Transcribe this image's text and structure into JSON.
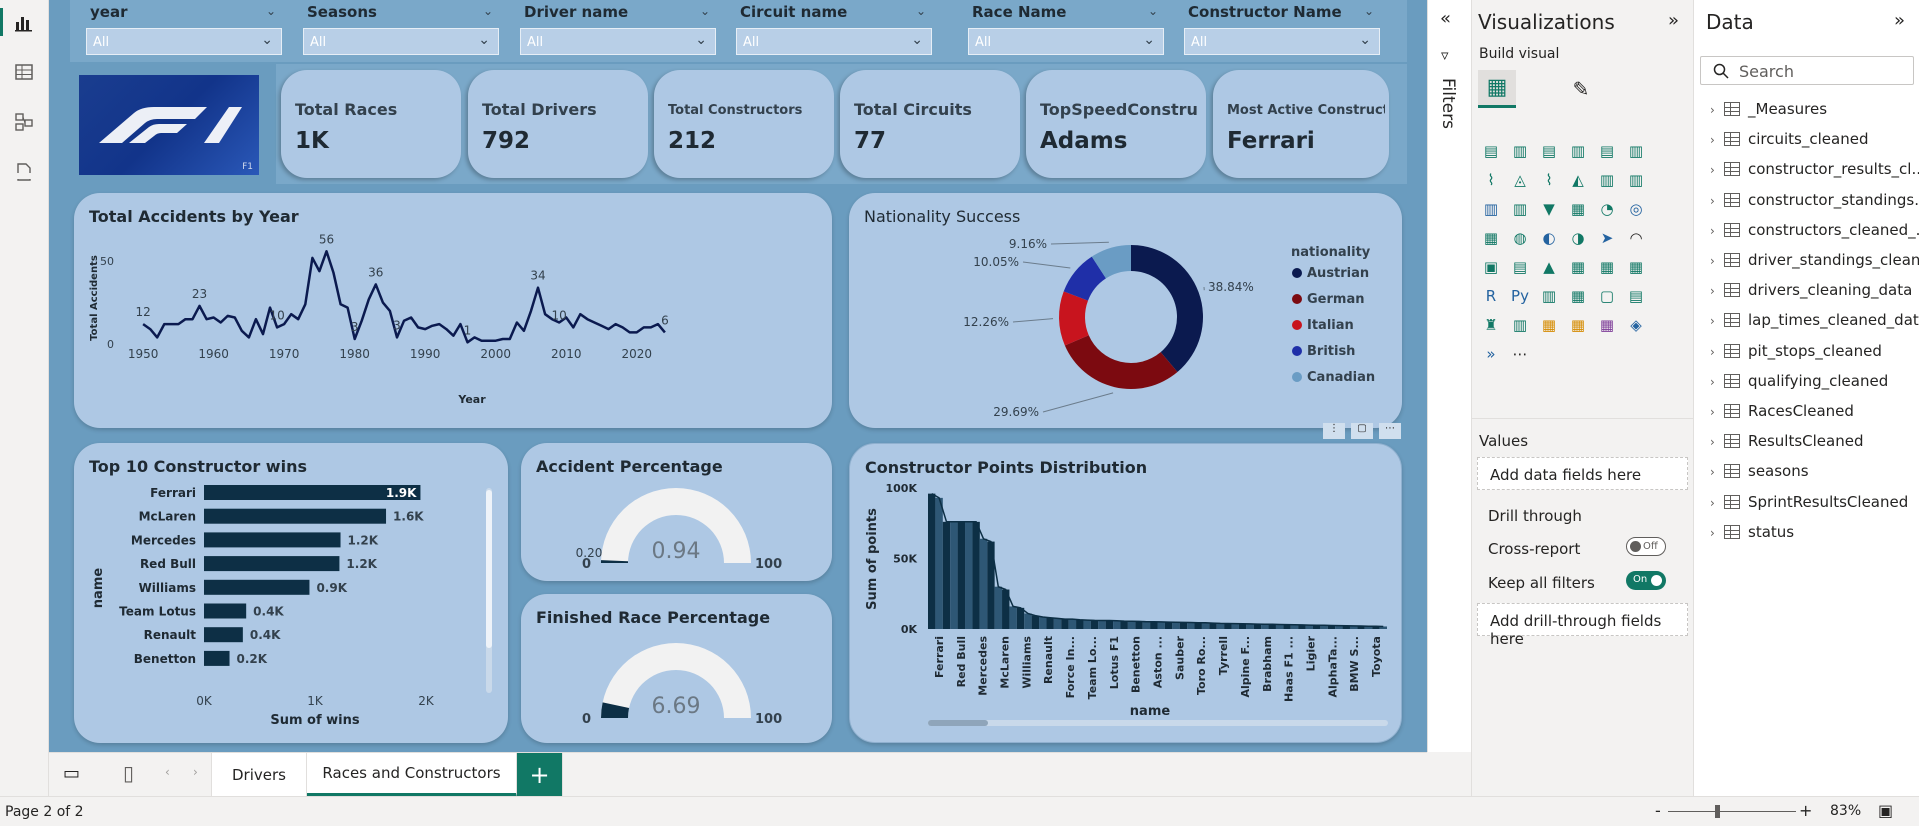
{
  "slicers": [
    {
      "label": "year",
      "value": "All"
    },
    {
      "label": "Seasons",
      "value": "All"
    },
    {
      "label": "Driver name",
      "value": "All"
    },
    {
      "label": "Circuit name",
      "value": "All"
    },
    {
      "label": "Race Name",
      "value": "All"
    },
    {
      "label": "Constructor Name",
      "value": "All"
    }
  ],
  "kpis": [
    {
      "label": "Total Races",
      "value": "1K"
    },
    {
      "label": "Total Drivers",
      "value": "792"
    },
    {
      "label": "Total Constructors",
      "value": "212"
    },
    {
      "label": "Total Circuits",
      "value": "77"
    },
    {
      "label": "TopSpeedConstruct...",
      "value": "Adams"
    },
    {
      "label": "Most Active Constructor",
      "value": "Ferrari"
    }
  ],
  "logo_text": "F1",
  "colors": {
    "page_bg": "#6a9cbf",
    "card_bg": "#aec8e4",
    "bar": "#0d2f45",
    "accent": "#117865"
  },
  "chart_data": [
    {
      "type": "line",
      "title": "Total Accidents by Year",
      "xlabel": "Year",
      "ylabel": "Total Accidents",
      "xlim": [
        1948,
        2025
      ],
      "ylim": [
        0,
        58
      ],
      "x_ticks": [
        "1950",
        "1960",
        "1970",
        "1980",
        "1990",
        "2000",
        "2010",
        "2020"
      ],
      "y_ticks": [
        "0",
        "50"
      ],
      "x": [
        1950,
        1951,
        1952,
        1953,
        1954,
        1955,
        1956,
        1957,
        1958,
        1959,
        1960,
        1961,
        1962,
        1963,
        1964,
        1965,
        1966,
        1967,
        1968,
        1969,
        1970,
        1971,
        1972,
        1973,
        1974,
        1975,
        1976,
        1977,
        1978,
        1979,
        1980,
        1981,
        1982,
        1983,
        1984,
        1985,
        1986,
        1987,
        1988,
        1989,
        1990,
        1991,
        1992,
        1993,
        1994,
        1995,
        1996,
        1997,
        1998,
        1999,
        2000,
        2001,
        2002,
        2003,
        2004,
        2005,
        2006,
        2007,
        2008,
        2009,
        2010,
        2011,
        2012,
        2013,
        2014,
        2015,
        2016,
        2017,
        2018,
        2019,
        2020,
        2021,
        2022,
        2023,
        2024
      ],
      "y": [
        12,
        9,
        4,
        12,
        12,
        12,
        15,
        15,
        23,
        15,
        16,
        13,
        17,
        16,
        8,
        4,
        15,
        6,
        22,
        10,
        12,
        18,
        15,
        24,
        52,
        44,
        56,
        43,
        24,
        22,
        3,
        14,
        27,
        36,
        25,
        20,
        4,
        14,
        16,
        10,
        9,
        11,
        12,
        9,
        5,
        12,
        1,
        4,
        2,
        2,
        2,
        3,
        3,
        13,
        8,
        20,
        34,
        18,
        15,
        13,
        16,
        10,
        18,
        15,
        13,
        11,
        9,
        12,
        10,
        7,
        7,
        10,
        10,
        12,
        7
      ],
      "point_labels": [
        {
          "x": 1950,
          "y": 12,
          "text": "12"
        },
        {
          "x": 1958,
          "y": 23,
          "text": "23"
        },
        {
          "x": 1969,
          "y": 10,
          "text": "10"
        },
        {
          "x": 1976,
          "y": 56,
          "text": "56"
        },
        {
          "x": 1980,
          "y": 3,
          "text": "3"
        },
        {
          "x": 1983,
          "y": 36,
          "text": "36"
        },
        {
          "x": 1986,
          "y": 4,
          "text": "3"
        },
        {
          "x": 1996,
          "y": 1,
          "text": "1"
        },
        {
          "x": 2006,
          "y": 34,
          "text": "34"
        },
        {
          "x": 2009,
          "y": 10,
          "text": "10"
        },
        {
          "x": 2024,
          "y": 7,
          "text": "6"
        }
      ]
    },
    {
      "type": "pie",
      "title": "Nationality Success",
      "legend_title": "nationality",
      "legend_position": "right",
      "labels": [
        "Austrian",
        "German",
        "Italian",
        "British",
        "Canadian"
      ],
      "values": [
        38.84,
        29.69,
        12.26,
        10.05,
        9.16
      ],
      "value_labels": [
        "38.84%",
        "29.69%",
        "12.26%",
        "10.05%",
        "9.16%"
      ],
      "colors": [
        "#0b1a4f",
        "#7c0a10",
        "#c8141e",
        "#1f2fa8",
        "#6a9cc4"
      ]
    },
    {
      "type": "bar",
      "orientation": "horizontal",
      "title": "Top 10 Constructor wins",
      "xlabel": "Sum of wins",
      "ylabel": "name",
      "xlim": [
        0,
        2000
      ],
      "x_ticks": [
        "0K",
        "1K",
        "2K"
      ],
      "categories": [
        "Ferrari",
        "McLaren",
        "Mercedes",
        "Red Bull",
        "Williams",
        "Team Lotus",
        "Renault",
        "Benetton"
      ],
      "values": [
        1950,
        1640,
        1230,
        1220,
        950,
        380,
        350,
        230
      ],
      "value_labels": [
        "1.9K",
        "1.6K",
        "1.2K",
        "1.2K",
        "0.9K",
        "0.4K",
        "0.4K",
        "0.2K"
      ]
    },
    {
      "type": "gauge",
      "title": "Accident Percentage",
      "value": 0.94,
      "value_label": "0.94",
      "target_label": "0.20",
      "min_label": "0",
      "max_label": "100",
      "min": 0,
      "max": 100
    },
    {
      "type": "gauge",
      "title": "Finished Race Percentage",
      "value": 6.69,
      "value_label": "6.69",
      "min_label": "0",
      "max_label": "100",
      "min": 0,
      "max": 100
    },
    {
      "type": "bar",
      "title": "Constructor Points Distribution",
      "xlabel": "name",
      "ylabel": "Sum of points",
      "ylim": [
        0,
        100000
      ],
      "y_ticks": [
        "0K",
        "50K",
        "100K"
      ],
      "categories": [
        "Ferrari",
        "Red Bull",
        "Mercedes",
        "McLaren",
        "Williams",
        "Renault",
        "Force In...",
        "Team Lo...",
        "Lotus F1",
        "Benetton",
        "Aston ...",
        "Sauber",
        "Toro Ro...",
        "Tyrrell",
        "Alpine F...",
        "Brabham",
        "Haas F1 ...",
        "Ligier",
        "AlphaTa...",
        "BMW S...",
        "Toyota"
      ],
      "values": [
        96000,
        93000,
        76000,
        76000,
        76000,
        76000,
        76000,
        64000,
        62000,
        30000,
        28000,
        16000,
        15000,
        11000,
        9500,
        8500,
        8000,
        7500,
        7000,
        7000,
        6500,
        6300,
        6100,
        6000,
        6000,
        5800,
        5600,
        5500,
        5400,
        5200,
        5100,
        5000,
        4900,
        4800,
        4700,
        4600,
        4500,
        4400,
        4200,
        4000,
        3900,
        3800,
        3700,
        3600,
        3500,
        3400,
        3300,
        3200,
        3100,
        3000,
        2900,
        2800,
        2700,
        2600,
        2500,
        2400,
        2300,
        2200,
        2100,
        2000,
        1900,
        1800
      ]
    }
  ],
  "panes": {
    "filters_label": "Filters",
    "viz_title": "Visualizations",
    "build_visual": "Build visual",
    "values_label": "Values",
    "values_placeholder": "Add data fields here",
    "drill_through": "Drill through",
    "cross_report": "Cross-report",
    "cross_report_state": "Off",
    "keep_filters": "Keep all filters",
    "keep_filters_state": "On",
    "drill_placeholder": "Add drill-through fields here",
    "data_title": "Data",
    "search_placeholder": "Search",
    "tables": [
      "_Measures",
      "circuits_cleaned",
      "constructor_results_cl...",
      "constructor_standings...",
      "constructors_cleaned_...",
      "driver_standings_clean...",
      "drivers_cleaning_data",
      "lap_times_cleaned_data",
      "pit_stops_cleaned",
      "qualifying_cleaned",
      "RacesCleaned",
      "ResultsCleaned",
      "seasons",
      "SprintResultsCleaned",
      "status"
    ]
  },
  "tabs": [
    {
      "label": "Drivers"
    },
    {
      "label": "Races and Constructors"
    }
  ],
  "add_tab": "+",
  "status": {
    "page": "Page 2 of 2",
    "zoom": "83%",
    "zoom_minus": "-",
    "zoom_plus": "+"
  }
}
